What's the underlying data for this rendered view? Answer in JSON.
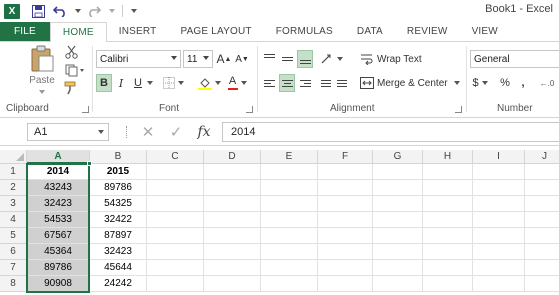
{
  "app": {
    "logo": "X",
    "title": "Book1 - Excel"
  },
  "qat": {
    "save_icon": "save-icon",
    "undo_icon": "undo-icon",
    "redo_icon": "redo-icon"
  },
  "tabs": [
    {
      "label": "FILE"
    },
    {
      "label": "HOME"
    },
    {
      "label": "INSERT"
    },
    {
      "label": "PAGE LAYOUT"
    },
    {
      "label": "FORMULAS"
    },
    {
      "label": "DATA"
    },
    {
      "label": "REVIEW"
    },
    {
      "label": "VIEW"
    }
  ],
  "ribbon": {
    "clipboard": {
      "label": "Clipboard",
      "paste": "Paste"
    },
    "font": {
      "label": "Font",
      "font_name": "Calibri",
      "font_size": "11",
      "grow": "A",
      "shrink": "A",
      "bold": "B",
      "italic": "I",
      "underline": "U",
      "font_color_letter": "A"
    },
    "alignment": {
      "label": "Alignment",
      "wrap_text": "Wrap Text",
      "merge_center": "Merge & Center"
    },
    "number": {
      "label": "Number",
      "format": "General",
      "currency": "$",
      "percent": "%",
      "comma": ","
    }
  },
  "formula_bar": {
    "name_box": "A1",
    "fx": "fx",
    "formula": "2014"
  },
  "sheet": {
    "columns": [
      "A",
      "B",
      "C",
      "D",
      "E",
      "F",
      "G",
      "H",
      "I",
      "J"
    ],
    "rows": [
      "1",
      "2",
      "3",
      "4",
      "5",
      "6",
      "7",
      "8"
    ],
    "cells": [
      [
        "2014",
        "2015"
      ],
      [
        "43243",
        "89786"
      ],
      [
        "32423",
        "54325"
      ],
      [
        "54533",
        "32422"
      ],
      [
        "67567",
        "87897"
      ],
      [
        "45364",
        "32423"
      ],
      [
        "89786",
        "45644"
      ],
      [
        "90908",
        "24242"
      ]
    ],
    "selected_column": "A",
    "active_cell": "A1"
  },
  "colors": {
    "accent": "#217346",
    "selection_fill": "#d0d0d0"
  }
}
